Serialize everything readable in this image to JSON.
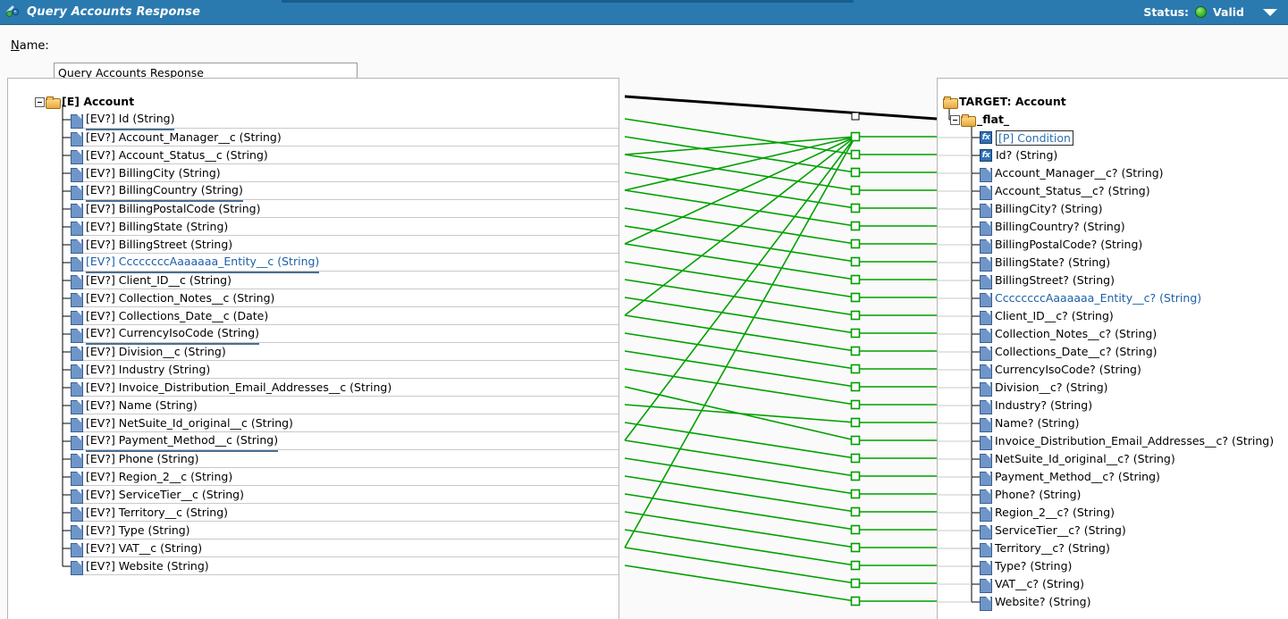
{
  "window": {
    "title": "Query Accounts Response",
    "icon": "link-chain-icon",
    "status_label": "Status:",
    "status_value": "Valid",
    "status_color": "#3fbb32",
    "menu_caret": "dropdown-caret-icon",
    "titlebar_color": "#2a7ab0"
  },
  "form": {
    "name_label": "Name:",
    "name_value": "Query Accounts Response",
    "name_placeholder": "Name"
  },
  "source_tree": {
    "root": {
      "label": "[E] Account",
      "icon": "folder-icon"
    },
    "items": [
      {
        "label": "[EV?] Id (String)",
        "icon": "field-icon",
        "style": "underlined"
      },
      {
        "label": "[EV?] Account_Manager__c (String)",
        "icon": "field-icon",
        "style": "normal"
      },
      {
        "label": "[EV?] Account_Status__c (String)",
        "icon": "field-icon",
        "style": "normal"
      },
      {
        "label": "[EV?] BillingCity (String)",
        "icon": "field-icon",
        "style": "normal"
      },
      {
        "label": "[EV?] BillingCountry (String)",
        "icon": "field-icon",
        "style": "underlined"
      },
      {
        "label": "[EV?] BillingPostalCode (String)",
        "icon": "field-icon",
        "style": "normal"
      },
      {
        "label": "[EV?] BillingState (String)",
        "icon": "field-icon",
        "style": "normal"
      },
      {
        "label": "[EV?] BillingStreet (String)",
        "icon": "field-icon",
        "style": "normal"
      },
      {
        "label": "[EV?] CcccccccAaaaaaa_Entity__c (String)",
        "icon": "field-icon",
        "style": "blue-underlined"
      },
      {
        "label": "[EV?] Client_ID__c (String)",
        "icon": "field-icon",
        "style": "normal"
      },
      {
        "label": "[EV?] Collection_Notes__c (String)",
        "icon": "field-icon",
        "style": "normal"
      },
      {
        "label": "[EV?] Collections_Date__c (Date)",
        "icon": "field-icon",
        "style": "normal"
      },
      {
        "label": "[EV?] CurrencyIsoCode (String)",
        "icon": "field-icon",
        "style": "underlined"
      },
      {
        "label": "[EV?] Division__c (String)",
        "icon": "field-icon",
        "style": "normal"
      },
      {
        "label": "[EV?] Industry (String)",
        "icon": "field-icon",
        "style": "normal"
      },
      {
        "label": "[EV?] Invoice_Distribution_Email_Addresses__c (String)",
        "icon": "field-icon",
        "style": "normal"
      },
      {
        "label": "[EV?] Name (String)",
        "icon": "field-icon",
        "style": "normal"
      },
      {
        "label": "[EV?] NetSuite_Id_original__c (String)",
        "icon": "field-icon",
        "style": "normal"
      },
      {
        "label": "[EV?] Payment_Method__c (String)",
        "icon": "field-icon",
        "style": "underlined"
      },
      {
        "label": "[EV?] Phone (String)",
        "icon": "field-icon",
        "style": "normal"
      },
      {
        "label": "[EV?] Region_2__c (String)",
        "icon": "field-icon",
        "style": "normal"
      },
      {
        "label": "[EV?] ServiceTier__c (String)",
        "icon": "field-icon",
        "style": "normal"
      },
      {
        "label": "[EV?] Territory__c (String)",
        "icon": "field-icon",
        "style": "normal"
      },
      {
        "label": "[EV?] Type (String)",
        "icon": "field-icon",
        "style": "normal"
      },
      {
        "label": "[EV?] VAT__c (String)",
        "icon": "field-icon",
        "style": "normal"
      },
      {
        "label": "[EV?] Website (String)",
        "icon": "field-icon",
        "style": "normal"
      }
    ]
  },
  "target_tree": {
    "root": {
      "label": "TARGET: Account",
      "icon": "folder-icon"
    },
    "group": {
      "label": "_flat_",
      "icon": "folder-icon"
    },
    "items": [
      {
        "label": "[P] Condition",
        "icon": "fx-icon",
        "style": "selected"
      },
      {
        "label": "Id? (String)",
        "icon": "fx-icon",
        "style": "normal"
      },
      {
        "label": "Account_Manager__c? (String)",
        "icon": "field-icon",
        "style": "normal"
      },
      {
        "label": "Account_Status__c? (String)",
        "icon": "field-icon",
        "style": "normal"
      },
      {
        "label": "BillingCity? (String)",
        "icon": "field-icon",
        "style": "normal"
      },
      {
        "label": "BillingCountry? (String)",
        "icon": "field-icon",
        "style": "normal"
      },
      {
        "label": "BillingPostalCode? (String)",
        "icon": "field-icon",
        "style": "normal"
      },
      {
        "label": "BillingState? (String)",
        "icon": "field-icon",
        "style": "normal"
      },
      {
        "label": "BillingStreet? (String)",
        "icon": "field-icon",
        "style": "normal"
      },
      {
        "label": "CcccccccAaaaaaa_Entity__c? (String)",
        "icon": "field-icon",
        "style": "blue"
      },
      {
        "label": "Client_ID__c? (String)",
        "icon": "field-icon",
        "style": "normal"
      },
      {
        "label": "Collection_Notes__c? (String)",
        "icon": "field-icon",
        "style": "normal"
      },
      {
        "label": "Collections_Date__c? (String)",
        "icon": "field-icon",
        "style": "normal"
      },
      {
        "label": "CurrencyIsoCode? (String)",
        "icon": "field-icon",
        "style": "normal"
      },
      {
        "label": "Division__c? (String)",
        "icon": "field-icon",
        "style": "normal"
      },
      {
        "label": "Industry? (String)",
        "icon": "field-icon",
        "style": "normal"
      },
      {
        "label": "Name? (String)",
        "icon": "field-icon",
        "style": "normal"
      },
      {
        "label": "Invoice_Distribution_Email_Addresses__c? (String)",
        "icon": "field-icon",
        "style": "normal"
      },
      {
        "label": "NetSuite_Id_original__c? (String)",
        "icon": "field-icon",
        "style": "normal"
      },
      {
        "label": "Payment_Method__c? (String)",
        "icon": "field-icon",
        "style": "normal"
      },
      {
        "label": "Phone? (String)",
        "icon": "field-icon",
        "style": "normal"
      },
      {
        "label": "Region_2__c? (String)",
        "icon": "field-icon",
        "style": "normal"
      },
      {
        "label": "ServiceTier__c? (String)",
        "icon": "field-icon",
        "style": "normal"
      },
      {
        "label": "Territory__c? (String)",
        "icon": "field-icon",
        "style": "normal"
      },
      {
        "label": "Type? (String)",
        "icon": "field-icon",
        "style": "normal"
      },
      {
        "label": "VAT__c? (String)",
        "icon": "field-icon",
        "style": "normal"
      },
      {
        "label": "Website? (String)",
        "icon": "field-icon",
        "style": "normal"
      }
    ]
  },
  "mapping": {
    "link_color": "#00a000",
    "root_link_color": "#000000",
    "node_shape": "square-node",
    "node_count": 27,
    "links": [
      {
        "source_row": -1,
        "target_row": -1,
        "color": "#000000"
      },
      {
        "source_row": 0,
        "target_row": 1
      },
      {
        "source_row": 1,
        "target_row": 2
      },
      {
        "source_row": 2,
        "target_row": 3
      },
      {
        "source_row": 3,
        "target_row": 4
      },
      {
        "source_row": 4,
        "target_row": 5
      },
      {
        "source_row": 5,
        "target_row": 6
      },
      {
        "source_row": 6,
        "target_row": 7
      },
      {
        "source_row": 7,
        "target_row": 8
      },
      {
        "source_row": 8,
        "target_row": 9
      },
      {
        "source_row": 9,
        "target_row": 10
      },
      {
        "source_row": 10,
        "target_row": 11
      },
      {
        "source_row": 11,
        "target_row": 12
      },
      {
        "source_row": 12,
        "target_row": 13
      },
      {
        "source_row": 13,
        "target_row": 14
      },
      {
        "source_row": 14,
        "target_row": 15
      },
      {
        "source_row": 16,
        "target_row": 16
      },
      {
        "source_row": 15,
        "target_row": 17
      },
      {
        "source_row": 17,
        "target_row": 18
      },
      {
        "source_row": 18,
        "target_row": 19
      },
      {
        "source_row": 19,
        "target_row": 20
      },
      {
        "source_row": 20,
        "target_row": 21
      },
      {
        "source_row": 21,
        "target_row": 22
      },
      {
        "source_row": 22,
        "target_row": 23
      },
      {
        "source_row": 23,
        "target_row": 24
      },
      {
        "source_row": 24,
        "target_row": 25
      },
      {
        "source_row": 25,
        "target_row": 26
      },
      {
        "source_row": 2,
        "target_row": 0
      },
      {
        "source_row": 4,
        "target_row": 0
      },
      {
        "source_row": 7,
        "target_row": 0
      },
      {
        "source_row": 11,
        "target_row": 0
      },
      {
        "source_row": 18,
        "target_row": 0
      },
      {
        "source_row": 24,
        "target_row": 0
      }
    ]
  }
}
